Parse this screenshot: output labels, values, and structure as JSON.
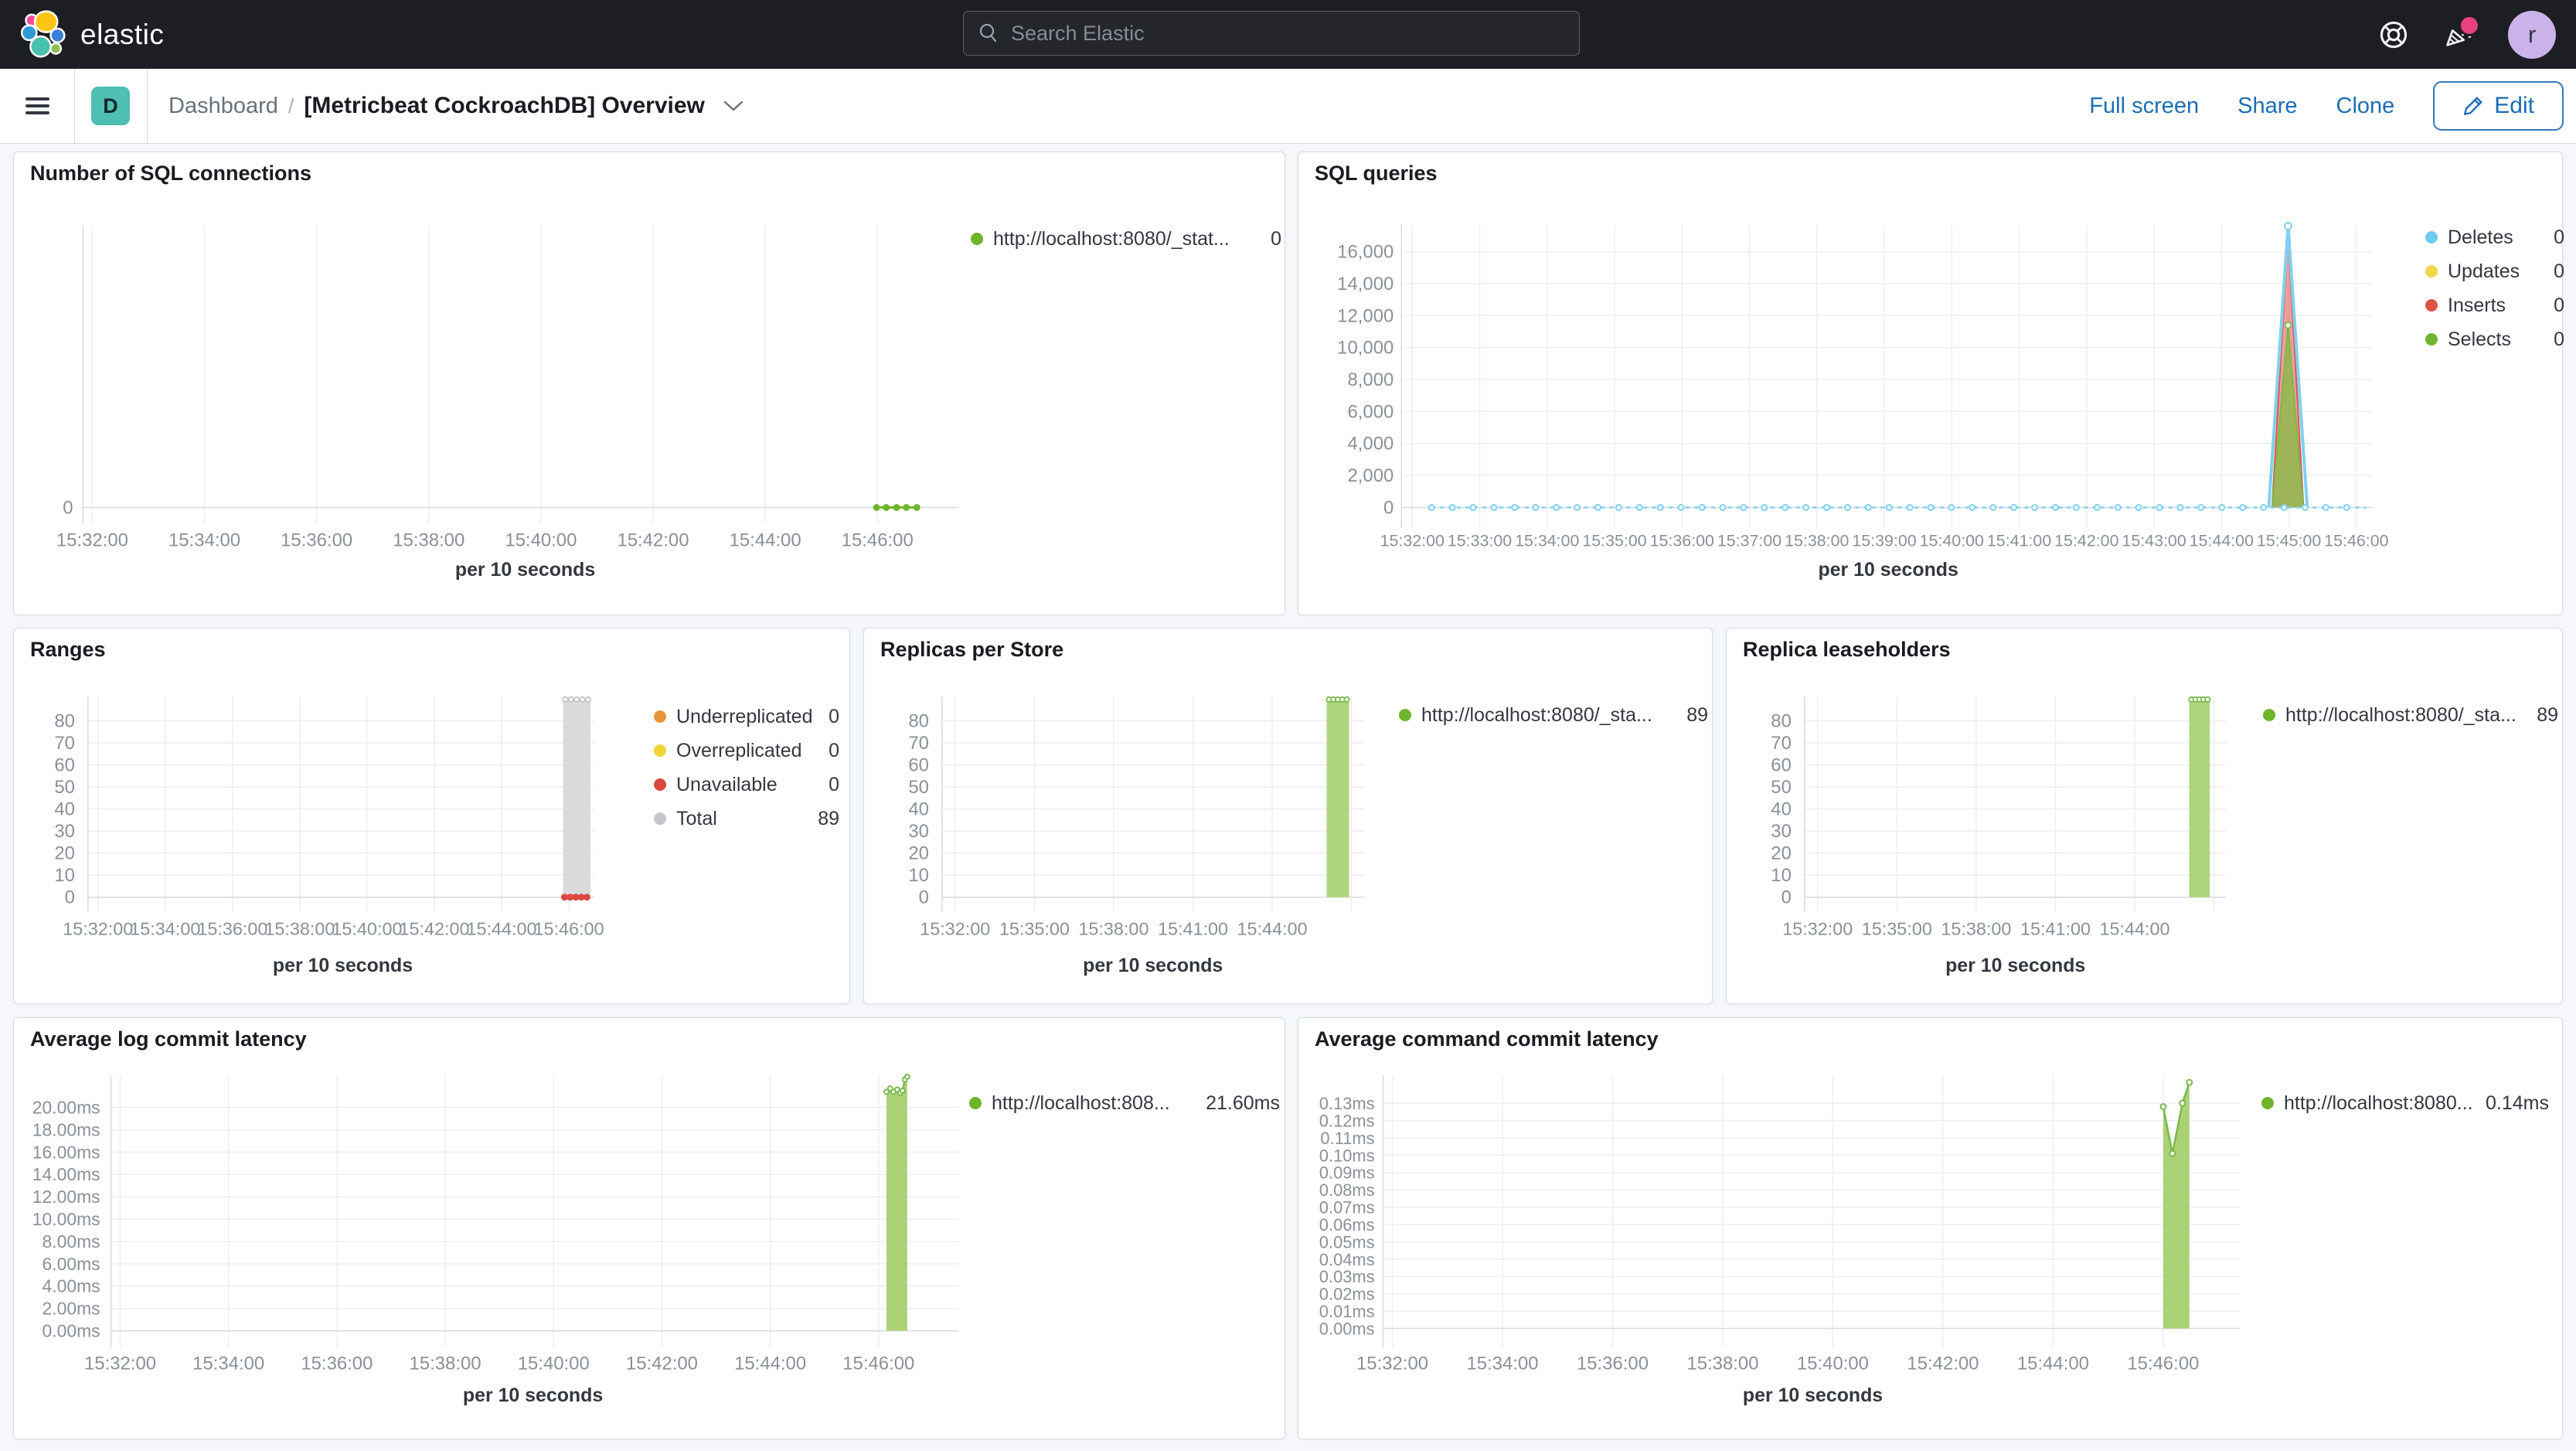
{
  "header": {
    "brand": "elastic",
    "search_placeholder": "Search Elastic",
    "avatar_letter": "r"
  },
  "nav": {
    "badge_letter": "D",
    "breadcrumb_root": "Dashboard",
    "breadcrumb_separator": "/",
    "breadcrumb_current": "[Metricbeat CockroachDB] Overview",
    "actions": {
      "full_screen": "Full screen",
      "share": "Share",
      "clone": "Clone",
      "edit": "Edit"
    }
  },
  "colors": {
    "header_bg": "#1D1E24",
    "page_bg": "#F5F7FA",
    "panel_border": "#D3DAE6",
    "accent_blue": "#1B6DB4",
    "badge_teal": "#4FBEB3",
    "avatar_lavender": "#CBB3EA",
    "notification_pink": "#E7417E",
    "series_green": "#6EB52C",
    "series_light_blue": "#6DCBF0",
    "series_yellow": "#F0D64B",
    "series_red": "#DE5347",
    "series_orange": "#E8953C",
    "series_gray": "#C5C7CC"
  },
  "chart_data": [
    {
      "id": "number-of-sql-connections",
      "type": "line",
      "title": "Number of SQL connections",
      "x_axis_title": "per 10 seconds",
      "x_ticks": [
        "15:32:00",
        "15:34:00",
        "15:36:00",
        "15:38:00",
        "15:40:00",
        "15:42:00",
        "15:44:00",
        "15:46:00"
      ],
      "y_ticks": [
        "0"
      ],
      "y_tick_values": [
        0
      ],
      "legend": [
        {
          "label": "http://localhost:8080/_stat...",
          "value": "0",
          "color": "#6EB52C"
        }
      ],
      "series": [
        {
          "type": "line",
          "name": "connections",
          "color": "#6EB52C",
          "width": 3,
          "markers": "solid",
          "marker_r": 3.5,
          "points": [
            [
              0.906,
              0
            ],
            [
              0.917,
              0
            ],
            [
              0.929,
              0
            ],
            [
              0.94,
              0
            ],
            [
              0.952,
              0
            ]
          ]
        }
      ]
    },
    {
      "id": "sql-queries",
      "type": "area",
      "title": "SQL queries",
      "x_axis_title": "per 10 seconds",
      "x_ticks": [
        "15:32:00",
        "15:33:00",
        "15:34:00",
        "15:35:00",
        "15:36:00",
        "15:37:00",
        "15:38:00",
        "15:39:00",
        "15:40:00",
        "15:41:00",
        "15:42:00",
        "15:43:00",
        "15:44:00",
        "15:45:00",
        "15:46:00"
      ],
      "y_ticks": [
        "16,000",
        "14,000",
        "12,000",
        "10,000",
        "8,000",
        "6,000",
        "4,000",
        "2,000",
        "0"
      ],
      "y_tick_values": [
        16000,
        14000,
        12000,
        10000,
        8000,
        6000,
        4000,
        2000,
        0
      ],
      "legend": [
        {
          "label": "Deletes",
          "value": "0",
          "color": "#6DCBF0"
        },
        {
          "label": "Updates",
          "value": "0",
          "color": "#F0D64B"
        },
        {
          "label": "Inserts",
          "value": "0",
          "color": "#DE5347"
        },
        {
          "label": "Selects",
          "value": "0",
          "color": "#6EB52C"
        }
      ],
      "series": [
        {
          "type": "area",
          "name": "Inserts spike",
          "color": "#DE5347",
          "fill": "rgba(222,83,71,0.55)",
          "width": 2,
          "points": [
            [
              0.897,
              0
            ],
            [
              0.9135,
              17100
            ],
            [
              0.9294,
              0
            ]
          ]
        },
        {
          "type": "area",
          "name": "Selects spike",
          "color": "#7CB84C",
          "fill": "rgba(136,186,70,0.78)",
          "width": 2,
          "markers": "hollow",
          "marker_r": 4,
          "marker_points": [
            [
              0.9135,
              11400
            ]
          ],
          "points": [
            [
              0.897,
              0
            ],
            [
              0.9135,
              11400
            ],
            [
              0.9294,
              0
            ]
          ]
        },
        {
          "type": "line",
          "name": "Deletes spike",
          "color": "#7FD0F2",
          "width": 4,
          "markers": "hollow",
          "marker_r": 4.5,
          "marker_points": [
            [
              0.9135,
              17600
            ]
          ],
          "points": [
            [
              0.8936,
              0
            ],
            [
              0.9135,
              17600
            ],
            [
              0.9333,
              0
            ]
          ]
        },
        {
          "type": "dotline",
          "name": "Deletes baseline",
          "color": "#7FD0F2",
          "value": 0,
          "x0": 0.031,
          "x1": 0.9944,
          "marker_step": 27,
          "marker_r": 3.5
        }
      ]
    },
    {
      "id": "ranges",
      "type": "bar",
      "title": "Ranges",
      "x_axis_title": "per 10 seconds",
      "x_ticks": [
        "15:32:00",
        "15:34:00",
        "15:36:00",
        "15:38:00",
        "15:40:00",
        "15:42:00",
        "15:44:00",
        "15:46:00"
      ],
      "y_ticks": [
        "80",
        "70",
        "60",
        "50",
        "40",
        "30",
        "20",
        "10",
        "0"
      ],
      "y_tick_values": [
        80,
        70,
        60,
        50,
        40,
        30,
        20,
        10,
        0
      ],
      "legend": [
        {
          "label": "Underreplicated",
          "value": "0",
          "color": "#E8953C"
        },
        {
          "label": "Overreplicated",
          "value": "0",
          "color": "#F1D335"
        },
        {
          "label": "Unavailable",
          "value": "0",
          "color": "#DB4840"
        },
        {
          "label": "Total",
          "value": "89",
          "color": "#C5C7CC"
        }
      ],
      "series": [
        {
          "type": "bar",
          "name": "Total",
          "fill": "#DBDBDB",
          "dot_color": "#C2C2C2",
          "x0": 0.938,
          "x1": 0.992,
          "value": 89,
          "top_dots": 5
        },
        {
          "type": "dots",
          "name": "Unavailable",
          "color": "#DB4840",
          "r": 4.5,
          "points": [
            [
              0.941,
              0
            ],
            [
              0.952,
              0
            ],
            [
              0.963,
              0
            ],
            [
              0.974,
              0
            ],
            [
              0.985,
              0
            ]
          ]
        }
      ]
    },
    {
      "id": "replicas-per-store",
      "type": "bar",
      "title": "Replicas per Store",
      "x_axis_title": "per 10 seconds",
      "x_ticks": [
        "15:32:00",
        "15:35:00",
        "15:38:00",
        "15:41:00",
        "15:44:00"
      ],
      "y_ticks": [
        "80",
        "70",
        "60",
        "50",
        "40",
        "30",
        "20",
        "10",
        "0"
      ],
      "y_tick_values": [
        80,
        70,
        60,
        50,
        40,
        30,
        20,
        10,
        0
      ],
      "legend": [
        {
          "label": "http://localhost:8080/_sta...",
          "value": "89",
          "color": "#6EB52C"
        }
      ],
      "series": [
        {
          "type": "bar",
          "name": "replicas",
          "fill": "#AFD47E",
          "dot_color": "#7CB84C",
          "x0": 0.912,
          "x1": 0.965,
          "value": 89,
          "top_dots": 5
        }
      ]
    },
    {
      "id": "replica-leaseholders",
      "type": "bar",
      "title": "Replica leaseholders",
      "x_axis_title": "per 10 seconds",
      "x_ticks": [
        "15:32:00",
        "15:35:00",
        "15:38:00",
        "15:41:00",
        "15:44:00"
      ],
      "y_ticks": [
        "80",
        "70",
        "60",
        "50",
        "40",
        "30",
        "20",
        "10",
        "0"
      ],
      "y_tick_values": [
        80,
        70,
        60,
        50,
        40,
        30,
        20,
        10,
        0
      ],
      "legend": [
        {
          "label": "http://localhost:8080/_sta...",
          "value": "89",
          "color": "#6EB52C"
        }
      ],
      "series": [
        {
          "type": "bar",
          "name": "leaseholders",
          "fill": "#AFD47E",
          "dot_color": "#7CB84C",
          "x0": 0.912,
          "x1": 0.961,
          "value": 89,
          "top_dots": 5
        }
      ]
    },
    {
      "id": "average-log-commit-latency",
      "type": "area",
      "title": "Average log commit latency",
      "x_axis_title": "per 10 seconds",
      "x_ticks": [
        "15:32:00",
        "15:34:00",
        "15:36:00",
        "15:38:00",
        "15:40:00",
        "15:42:00",
        "15:44:00",
        "15:46:00"
      ],
      "y_ticks": [
        "20.00ms",
        "18.00ms",
        "16.00ms",
        "14.00ms",
        "12.00ms",
        "10.00ms",
        "8.00ms",
        "6.00ms",
        "4.00ms",
        "2.00ms",
        "0.00ms"
      ],
      "y_tick_values": [
        20,
        18,
        16,
        14,
        12,
        10,
        8,
        6,
        4,
        2,
        0
      ],
      "legend": [
        {
          "label": "http://localhost:808...",
          "value": "21.60ms",
          "color": "#6EB52C"
        }
      ],
      "series": [
        {
          "type": "area",
          "name": "log commit latency",
          "color": "#7CB84C",
          "fill": "#ABD276",
          "width": 2.5,
          "markers": "hollow",
          "marker_r": 3,
          "points": [
            [
              0.9147,
              21.4
            ],
            [
              0.9191,
              21.7
            ],
            [
              0.9228,
              21.4
            ],
            [
              0.9273,
              21.6
            ],
            [
              0.931,
              21.3
            ],
            [
              0.9337,
              21.5
            ],
            [
              0.9364,
              22.5
            ],
            [
              0.9392,
              22.75
            ]
          ]
        }
      ]
    },
    {
      "id": "average-command-commit-latency",
      "type": "area",
      "title": "Average command commit latency",
      "x_axis_title": "per 10 seconds",
      "x_ticks": [
        "15:32:00",
        "15:34:00",
        "15:36:00",
        "15:38:00",
        "15:40:00",
        "15:42:00",
        "15:44:00",
        "15:46:00"
      ],
      "y_ticks": [
        "0.13ms",
        "0.12ms",
        "0.11ms",
        "0.10ms",
        "0.09ms",
        "0.08ms",
        "0.07ms",
        "0.06ms",
        "0.05ms",
        "0.04ms",
        "0.03ms",
        "0.02ms",
        "0.01ms",
        "0.00ms"
      ],
      "y_tick_values": [
        0.13,
        0.12,
        0.11,
        0.1,
        0.09,
        0.08,
        0.07,
        0.06,
        0.05,
        0.04,
        0.03,
        0.02,
        0.01,
        0
      ],
      "legend": [
        {
          "label": "http://localhost:8080...",
          "value": "0.14ms",
          "color": "#6EB52C"
        }
      ],
      "series": [
        {
          "type": "area",
          "name": "command commit latency",
          "color": "#7CB84C",
          "fill": "#ABD276",
          "width": 2.5,
          "markers": "hollow",
          "marker_r": 3.5,
          "points": [
            [
              0.9102,
              0.128
            ],
            [
              0.9209,
              0.101
            ],
            [
              0.9326,
              0.13
            ],
            [
              0.9407,
              0.142
            ]
          ]
        }
      ]
    }
  ]
}
